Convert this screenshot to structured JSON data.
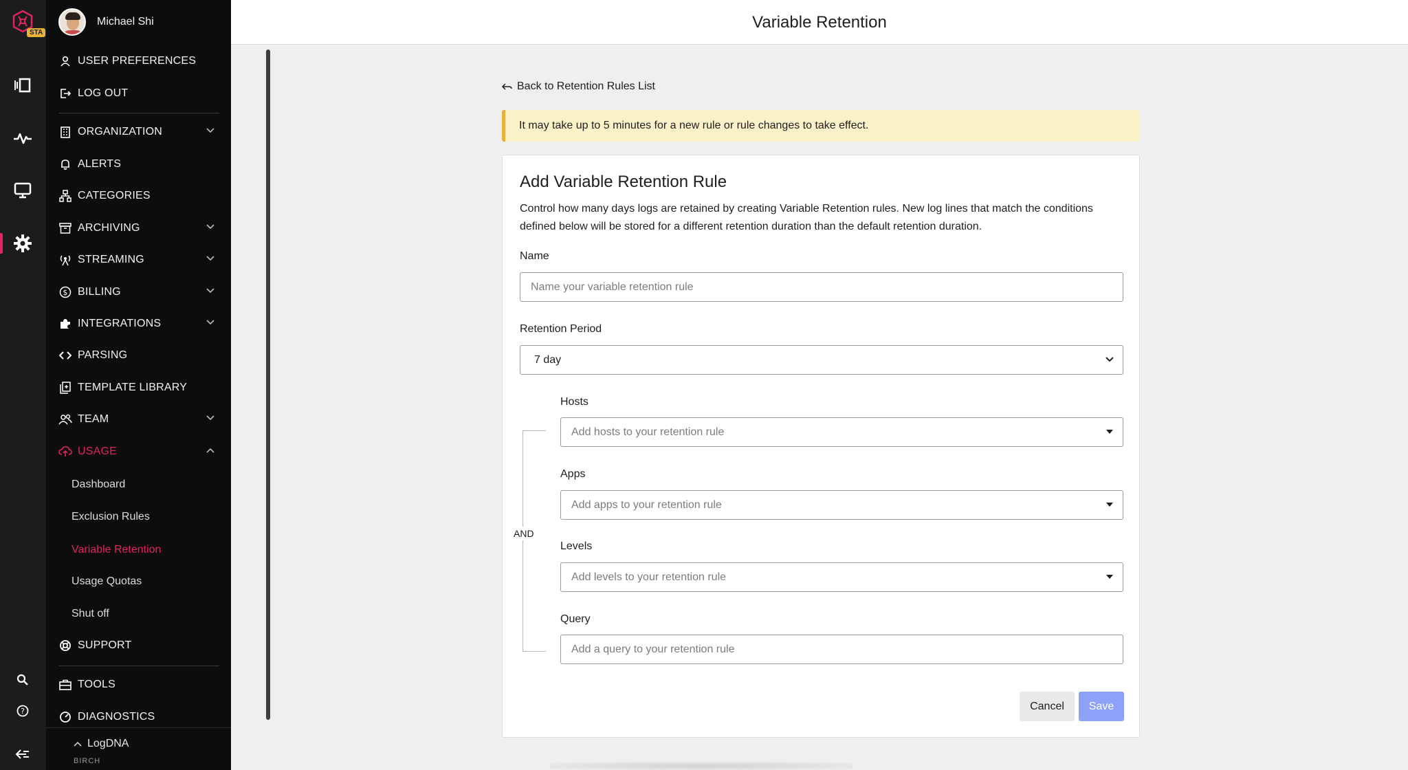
{
  "app": {
    "badge": "STA",
    "accent_color": "#e0245e",
    "rail_icons": [
      "views-icon",
      "pulse-icon",
      "monitor-icon",
      "gear-icon",
      "search-icon",
      "help-icon",
      "collapse-icon"
    ]
  },
  "user": {
    "name": "Michael Shi"
  },
  "nav": {
    "preferences": "USER PREFERENCES",
    "logout": "LOG OUT",
    "items": [
      {
        "label": "ORGANIZATION",
        "icon": "building-icon",
        "chevron": true
      },
      {
        "label": "ALERTS",
        "icon": "bell-icon",
        "chevron": false
      },
      {
        "label": "CATEGORIES",
        "icon": "hierarchy-icon",
        "chevron": false
      },
      {
        "label": "ARCHIVING",
        "icon": "archive-icon",
        "chevron": true
      },
      {
        "label": "STREAMING",
        "icon": "broadcast-icon",
        "chevron": true
      },
      {
        "label": "BILLING",
        "icon": "dollar-icon",
        "chevron": true
      },
      {
        "label": "INTEGRATIONS",
        "icon": "puzzle-icon",
        "chevron": true
      },
      {
        "label": "PARSING",
        "icon": "code-icon",
        "chevron": false
      },
      {
        "label": "TEMPLATE LIBRARY",
        "icon": "template-icon",
        "chevron": false
      },
      {
        "label": "TEAM",
        "icon": "team-icon",
        "chevron": true
      },
      {
        "label": "USAGE",
        "icon": "cloud-upload-icon",
        "chevron": true
      }
    ],
    "usage_sub": [
      "Dashboard",
      "Exclusion Rules",
      "Variable Retention",
      "Usage Quotas",
      "Shut off"
    ],
    "support": "SUPPORT",
    "tools": "TOOLS",
    "diagnostics": "DIAGNOSTICS",
    "org": "LogDNA",
    "plan": "BIRCH"
  },
  "header": {
    "title": "Variable Retention"
  },
  "back_link": "Back to Retention Rules List",
  "notice": "It may take up to 5 minutes for a new rule or rule changes to take effect.",
  "form": {
    "title": "Add Variable Retention Rule",
    "description": "Control how many days logs are retained by creating Variable Retention rules. New log lines that match the conditions defined below will be stored for a different retention duration than the default retention duration.",
    "name_label": "Name",
    "name_placeholder": "Name your variable retention rule",
    "period_label": "Retention Period",
    "period_value": "7 day",
    "and_label": "AND",
    "hosts_label": "Hosts",
    "hosts_placeholder": "Add hosts to your retention rule",
    "apps_label": "Apps",
    "apps_placeholder": "Add apps to your retention rule",
    "levels_label": "Levels",
    "levels_placeholder": "Add levels to your retention rule",
    "query_label": "Query",
    "query_placeholder": "Add a query to your retention rule",
    "cancel": "Cancel",
    "save": "Save"
  }
}
